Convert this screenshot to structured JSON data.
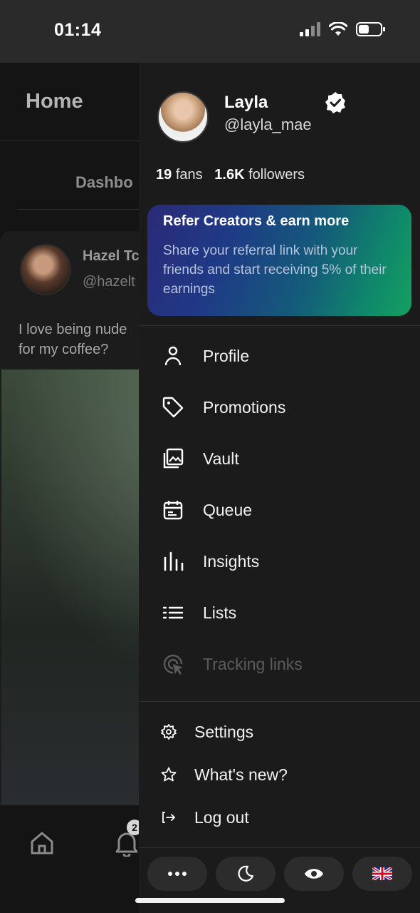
{
  "status_bar": {
    "time": "01:14"
  },
  "background": {
    "header_title": "Home",
    "active_tab": "Dashbo",
    "post": {
      "author_name": "Hazel Tc",
      "author_handle": "@hazelt",
      "text": "I love being nude for my coffee?"
    },
    "notification_count": "2"
  },
  "drawer": {
    "profile": {
      "name": "Layla",
      "handle": "@layla_mae",
      "verified": true,
      "fans_count": "19",
      "fans_label": "fans",
      "followers_count": "1.6K",
      "followers_label": "followers"
    },
    "refer_card": {
      "title": "Refer Creators & earn more",
      "body": "Share your referral link with your friends and start receiving 5% of their earnings",
      "gradient_start": "#2b2a78",
      "gradient_end": "#15a060"
    },
    "menu": [
      {
        "label": "Profile",
        "icon": "user-icon"
      },
      {
        "label": "Promotions",
        "icon": "tag-icon"
      },
      {
        "label": "Vault",
        "icon": "gallery-icon"
      },
      {
        "label": "Queue",
        "icon": "calendar-icon"
      },
      {
        "label": "Insights",
        "icon": "bar-chart-icon"
      },
      {
        "label": "Lists",
        "icon": "list-icon"
      },
      {
        "label": "Tracking links",
        "icon": "cursor-click-icon",
        "disabled": true
      }
    ],
    "secondary_menu": [
      {
        "label": "Settings",
        "icon": "gear-icon"
      },
      {
        "label": "What's new?",
        "icon": "star-icon"
      },
      {
        "label": "Log out",
        "icon": "logout-icon"
      }
    ],
    "bottom_buttons": [
      "more-icon",
      "moon-icon",
      "eye-icon",
      "uk-flag-icon"
    ]
  }
}
